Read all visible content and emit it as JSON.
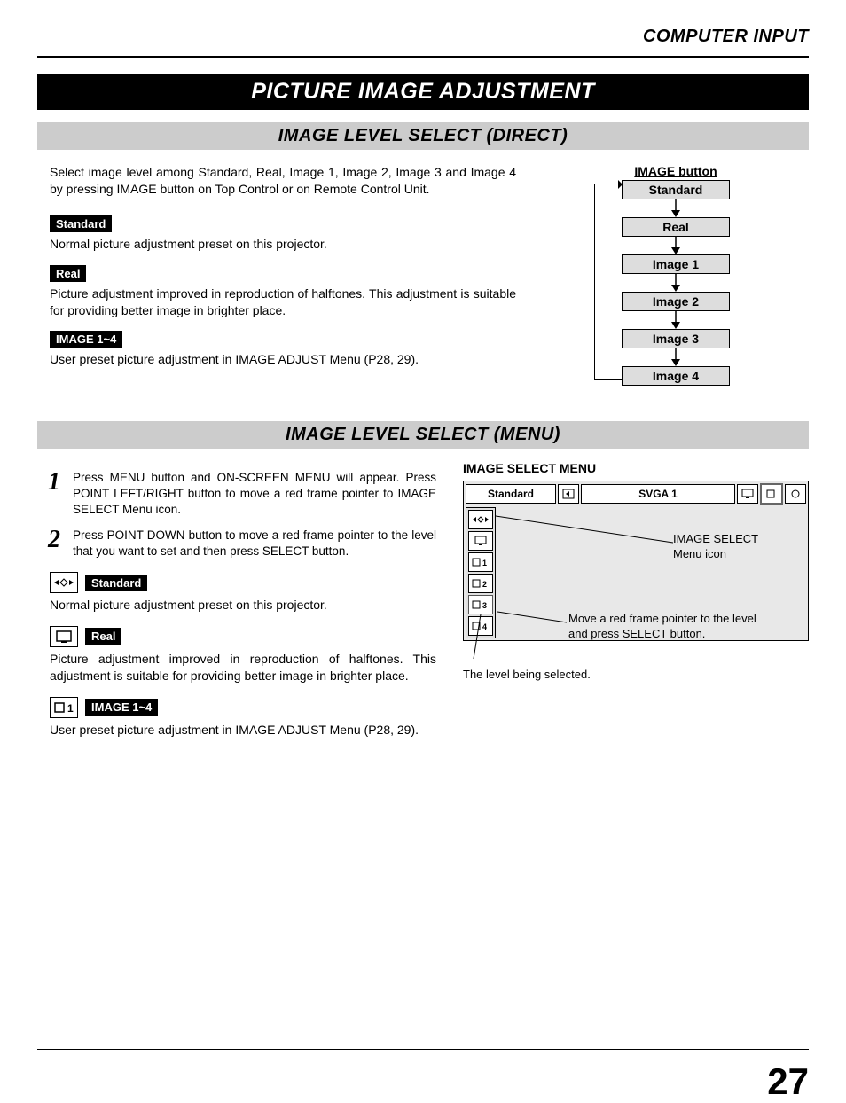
{
  "header": "COMPUTER INPUT",
  "title": "PICTURE IMAGE ADJUSTMENT",
  "section1": {
    "heading": "IMAGE LEVEL SELECT (DIRECT)",
    "intro": "Select image level among Standard, Real, Image 1, Image 2, Image 3 and Image 4 by pressing IMAGE button on Top Control or on Remote Control Unit.",
    "blocks": [
      {
        "label": "Standard",
        "desc": "Normal picture adjustment preset on this projector."
      },
      {
        "label": "Real",
        "desc": "Picture adjustment improved in reproduction of halftones.  This adjustment is suitable for providing better image in brighter place."
      },
      {
        "label": "IMAGE 1~4",
        "desc": "User preset picture adjustment in IMAGE ADJUST Menu (P28, 29)."
      }
    ],
    "flow": {
      "head": "IMAGE button",
      "items": [
        "Standard",
        "Real",
        "Image 1",
        "Image 2",
        "Image 3",
        "Image 4"
      ]
    }
  },
  "section2": {
    "heading": "IMAGE LEVEL SELECT (MENU)",
    "steps": [
      {
        "num": "1",
        "text": "Press MENU button and ON-SCREEN MENU will appear.  Press POINT LEFT/RIGHT button to move a red frame pointer to IMAGE SELECT Menu icon."
      },
      {
        "num": "2",
        "text": "Press POINT DOWN button to move a red frame pointer to the level that you want to set and then press SELECT button."
      }
    ],
    "blocks": [
      {
        "icon": "std",
        "label": "Standard",
        "desc": "Normal picture adjustment preset on this projector."
      },
      {
        "icon": "real",
        "label": "Real",
        "desc": "Picture adjustment improved in reproduction of halftones.  This adjustment is suitable for providing better image in brighter place."
      },
      {
        "icon": "img1",
        "label": "IMAGE 1~4",
        "desc": "User preset picture adjustment in IMAGE ADJUST Menu (P28, 29)."
      }
    ],
    "menu": {
      "title": "IMAGE SELECT MENU",
      "top_label": "Standard",
      "top_signal": "SVGA 1",
      "callout1": "IMAGE SELECT Menu icon",
      "callout2": "Move a red frame pointer to the level and press SELECT button.",
      "caption": "The level being selected."
    }
  },
  "page_number": "27"
}
